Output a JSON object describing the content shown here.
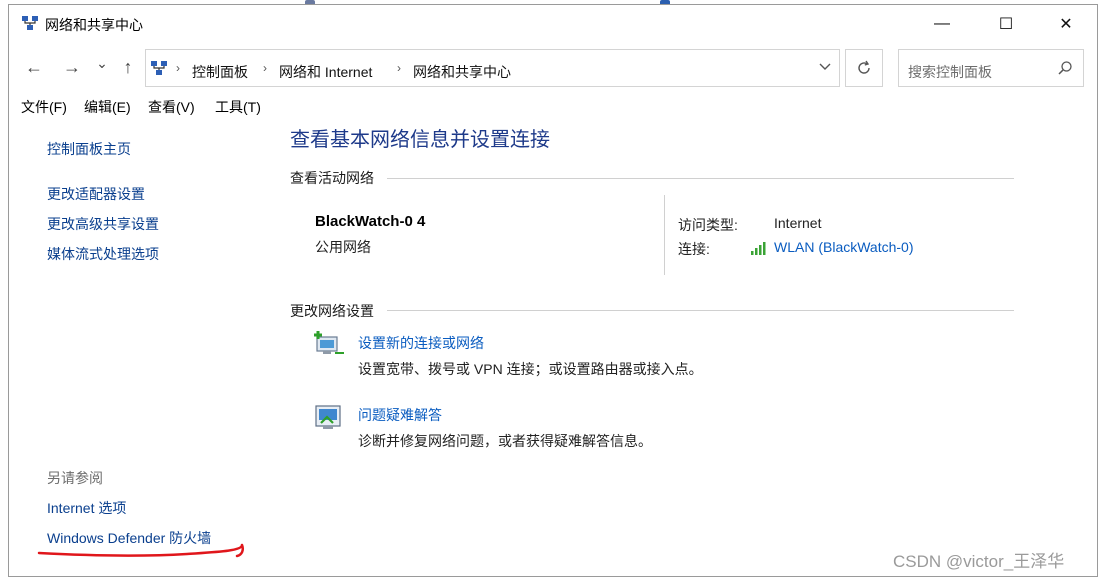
{
  "window": {
    "title": "网络和共享中心",
    "controls": {
      "minimize": "—",
      "maximize": "☐",
      "close": "✕"
    }
  },
  "nav": {
    "back": "←",
    "forward": "→",
    "recent": "⌄",
    "up": "↑"
  },
  "address": {
    "breadcrumbs": [
      "控制面板",
      "网络和 Internet",
      "网络和共享中心"
    ],
    "separator": "›"
  },
  "search": {
    "placeholder": "搜索控制面板"
  },
  "menu": [
    "文件(F)",
    "编辑(E)",
    "查看(V)",
    "工具(T)"
  ],
  "left_pane": {
    "home": "控制面板主页",
    "links": [
      "更改适配器设置",
      "更改高级共享设置",
      "媒体流式处理选项"
    ],
    "see_also_label": "另请参阅",
    "see_also": [
      "Internet 选项",
      "Windows Defender 防火墙"
    ]
  },
  "main": {
    "title": "查看基本网络信息并设置连接",
    "active_networks_heading": "查看活动网络",
    "network": {
      "name": "BlackWatch-0 4",
      "category": "公用网络",
      "access_type_label": "访问类型:",
      "access_type_value": "Internet",
      "connections_label": "连接:",
      "connection_value": "WLAN (BlackWatch-0)"
    },
    "change_settings_heading": "更改网络设置",
    "tasks": [
      {
        "title": "设置新的连接或网络",
        "description": "设置宽带、拨号或 VPN 连接；或设置路由器或接入点。",
        "icon": "network-setup-icon"
      },
      {
        "title": "问题疑难解答",
        "description": "诊断并修复网络问题，或者获得疑难解答信息。",
        "icon": "troubleshoot-icon"
      }
    ]
  },
  "watermark": "CSDN @victor_王泽华",
  "colors": {
    "link": "#0a5cc0",
    "title_blue": "#1e3a8a",
    "annotation_red": "#e0161b"
  }
}
